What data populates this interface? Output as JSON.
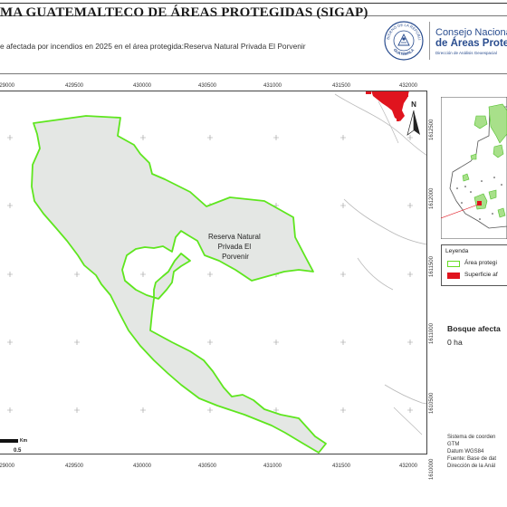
{
  "header": {
    "title": "MA GUATEMALTECO DE ÁREAS PROTEGIDAS  (SIGAP)",
    "subtitle": "e afectada por incendios en 2025 en el área protegida:Reserva Natural Privada El Porvenir"
  },
  "logo": {
    "seal_text_top": "GOBIERNO DE LA REPÚBLICA",
    "seal_text_bottom": "GUATEMALA",
    "org_line1": "Consejo Nacional",
    "org_line2": "de Áreas Protegid",
    "org_line3": "Dirección de Análisis Geoespacial"
  },
  "axes": {
    "x_top": [
      "429000",
      "429500",
      "430000",
      "430500",
      "431000",
      "431500",
      "432000"
    ],
    "x_bottom": [
      "429000",
      "429500",
      "430000",
      "430500",
      "431000",
      "431500",
      "432000"
    ],
    "y_right": [
      "1612500",
      "1612000",
      "1611500",
      "1611000",
      "1610500",
      "1610000"
    ]
  },
  "map": {
    "area_label_lines": [
      "Reserva Natural",
      "Privada El",
      "Porvenir"
    ],
    "north_label": "N",
    "scale_label": "0.5",
    "scale_unit": "Km"
  },
  "legend": {
    "title": "Leyenda",
    "items": [
      {
        "label": "Área protegi",
        "fill": "#ffffff",
        "stroke": "#66dd22"
      },
      {
        "label": "Superficie af",
        "fill": "#e0141e",
        "stroke": "#e0141e"
      }
    ]
  },
  "forest": {
    "title": "Bosque afecta",
    "value": "0 ha"
  },
  "metadata": {
    "lines": [
      "Sistema de coorden",
      "GTM",
      "Datum WGS84",
      "Fuente: Base de dat",
      "Dirección de la Anál"
    ]
  },
  "colors": {
    "area_fill": "#e4e7e4",
    "area_stroke": "#5ee61e",
    "fire": "#e0141e",
    "road": "#b8b8b8",
    "grid_cross": "#9a9a9a",
    "brand_blue": "#2a4d8f"
  }
}
